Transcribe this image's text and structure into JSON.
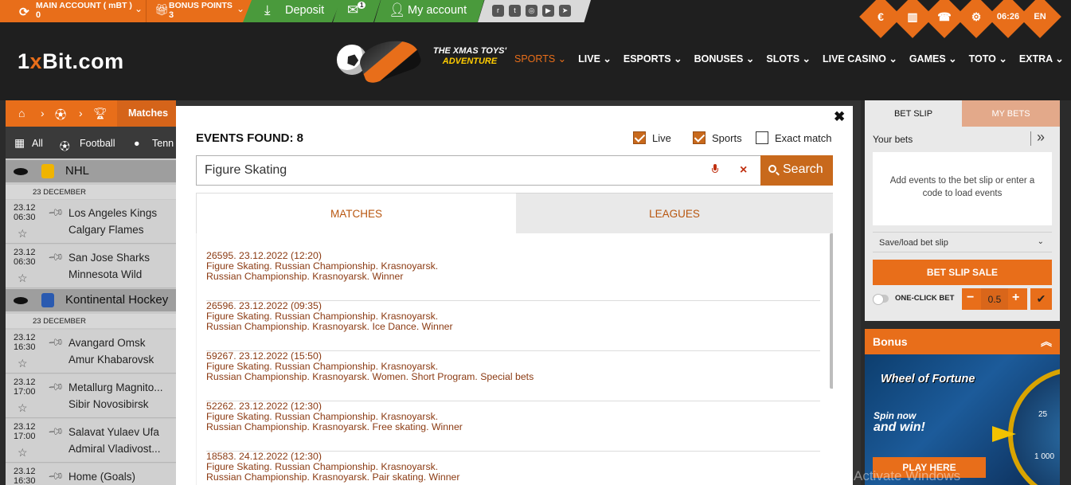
{
  "topbar": {
    "account_label": "MAIN ACCOUNT ( mBT )",
    "account_value": "0",
    "bonus_label": "BONUS POINTS",
    "bonus_value": "3",
    "deposit_label": "Deposit",
    "mail_count": "1",
    "my_account_label": "My account",
    "time": "06:26",
    "language": "EN"
  },
  "header": {
    "logo_prefix": "1",
    "logo_x": "x",
    "logo_rest": "Bit.com",
    "promo_line1": "THE XMAS TOYS'",
    "promo_line2": "ADVENTURE",
    "nav": [
      "SPORTS",
      "LIVE",
      "ESPORTS",
      "BONUSES",
      "SLOTS",
      "LIVE CASINO",
      "GAMES",
      "TOTO",
      "EXTRA"
    ]
  },
  "left": {
    "breadcrumb_current": "Matches",
    "sport_tabs": [
      "All",
      "Football",
      "Tenn"
    ],
    "leagues": [
      "NHL",
      "Kontinental Hockey"
    ],
    "date_label": "23 DECEMBER",
    "matches": [
      {
        "date": "23.12",
        "time": "06:30",
        "team1": "Los Angeles Kings",
        "team2": "Calgary Flames"
      },
      {
        "date": "23.12",
        "time": "06:30",
        "team1": "San Jose Sharks",
        "team2": "Minnesota Wild"
      },
      {
        "date": "23.12",
        "time": "16:30",
        "team1": "Avangard Omsk",
        "team2": "Amur Khabarovsk"
      },
      {
        "date": "23.12",
        "time": "17:00",
        "team1": "Metallurg Magnito...",
        "team2": "Sibir Novosibirsk"
      },
      {
        "date": "23.12",
        "time": "17:00",
        "team1": "Salavat Yulaev Ufa",
        "team2": "Admiral Vladivost..."
      },
      {
        "date": "23.12",
        "time": "16:30",
        "team1": "Home (Goals)",
        "team2": ""
      }
    ]
  },
  "modal": {
    "events_found": "EVENTS FOUND: 8",
    "live_label": "Live",
    "sports_label": "Sports",
    "exact_label": "Exact match",
    "search_value": "Figure Skating",
    "search_button": "Search",
    "tab_matches": "MATCHES",
    "tab_leagues": "LEAGUES",
    "results": [
      {
        "l1": "26595. 23.12.2022 (12:20)",
        "l2": "Figure Skating. Russian Championship. Krasnoyarsk.",
        "l3": "Russian Championship. Krasnoyarsk. Winner"
      },
      {
        "l1": "26596. 23.12.2022 (09:35)",
        "l2": "Figure Skating. Russian Championship. Krasnoyarsk.",
        "l3": "Russian Championship. Krasnoyarsk. Ice Dance. Winner"
      },
      {
        "l1": "59267. 23.12.2022 (15:50)",
        "l2": "Figure Skating. Russian Championship. Krasnoyarsk.",
        "l3": "Russian Championship. Krasnoyarsk. Women. Short Program. Special bets"
      },
      {
        "l1": "52262. 23.12.2022 (12:30)",
        "l2": "Figure Skating. Russian Championship. Krasnoyarsk.",
        "l3": "Russian Championship. Krasnoyarsk. Free skating. Winner"
      },
      {
        "l1": "18583. 24.12.2022 (12:30)",
        "l2": "Figure Skating. Russian Championship. Krasnoyarsk.",
        "l3": "Russian Championship. Krasnoyarsk. Pair skating. Winner"
      }
    ]
  },
  "slip": {
    "tab_bet_slip": "BET SLIP",
    "tab_my_bets": "MY BETS",
    "your_bets": "Your bets",
    "empty_text": "Add events to the bet slip or enter a code to load events",
    "save_load": "Save/load bet slip",
    "slip_sale": "BET SLIP SALE",
    "one_click": "ONE-CLICK BET",
    "stake": "0.5"
  },
  "bonus": {
    "title": "Bonus",
    "wheel_title": "Wheel of Fortune",
    "spin_now": "Spin now",
    "and_win": "and win!",
    "num1": "25",
    "num2": "1 000",
    "play_here": "PLAY HERE"
  },
  "watermark": "Activate Windows",
  "colors": {
    "accent": "#e86e1a",
    "green": "#4a9a3c",
    "result_text": "#8b3a12"
  }
}
